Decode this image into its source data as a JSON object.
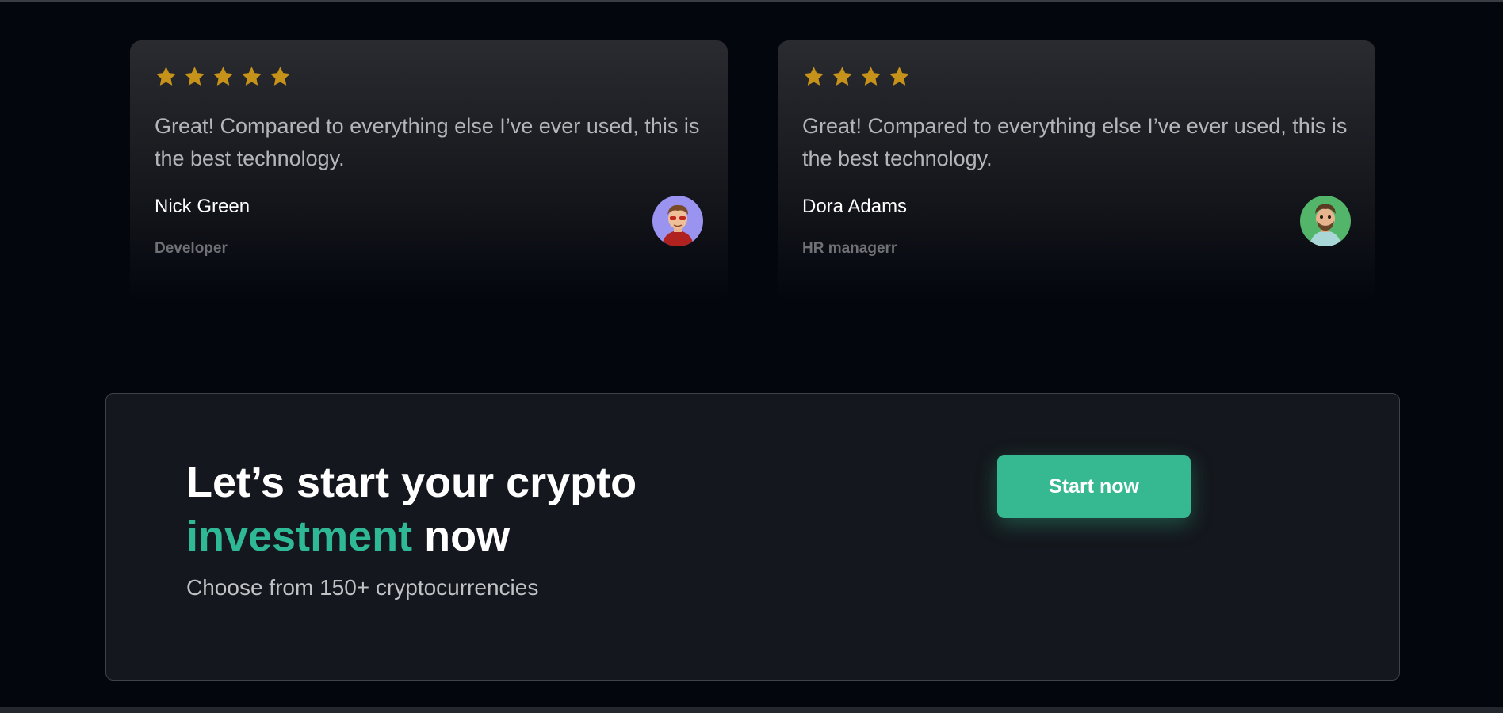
{
  "colors": {
    "star": "#c7921a",
    "accent": "#2fb895",
    "button": "#36b991",
    "background": "#03060d"
  },
  "testimonials": [
    {
      "rating": 5,
      "quote": "Great! Compared to everything else I’ve ever used, this is the best technology.",
      "name": "Nick Green",
      "role": "Developer",
      "avatar_icon": "avatar-purple-icon"
    },
    {
      "rating": 4,
      "quote": "Great! Compared to everything else I’ve ever used, this is the best technology.",
      "name": "Dora Adams",
      "role": "HR managerr",
      "avatar_icon": "avatar-green-icon"
    }
  ],
  "cta": {
    "title_line1": "Let’s start your crypto",
    "title_accent": "investment",
    "title_end": " now",
    "subtitle": "Choose from 150+ cryptocurrencies",
    "button_label": "Start now"
  }
}
